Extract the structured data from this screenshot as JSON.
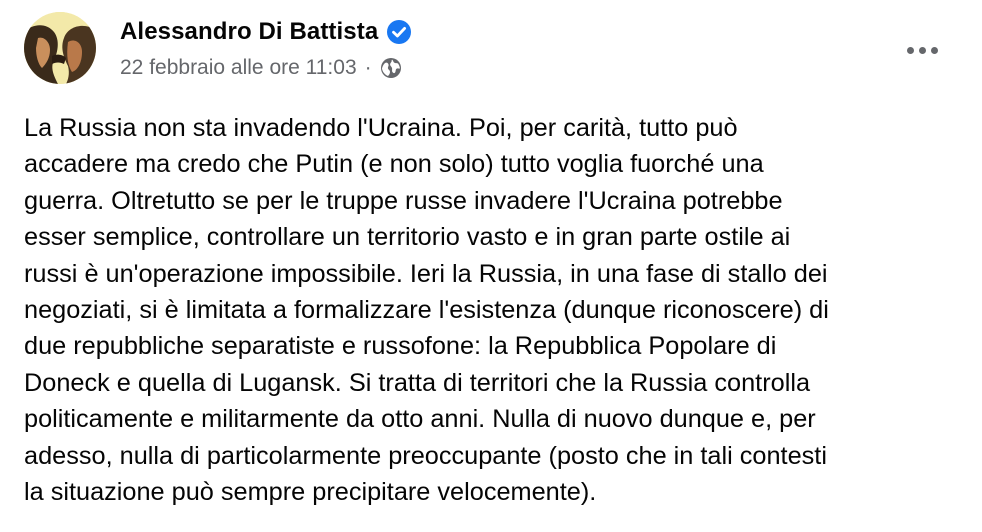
{
  "author": {
    "name": "Alessandro Di Battista",
    "verified": true
  },
  "meta": {
    "timestamp": "22 febbraio alle ore 11:03",
    "separator": "·",
    "audience_icon": "globe-icon"
  },
  "actions": {
    "more_icon": "more-options-icon"
  },
  "post": {
    "lines": [
      "La Russia non sta invadendo l'Ucraina. Poi, per carità, tutto può",
      "accadere ma credo che Putin (e non solo) tutto voglia fuorché una",
      "guerra. Oltretutto se per le truppe russe invadere l'Ucraina potrebbe",
      "esser semplice, controllare un territorio vasto e in gran parte ostile ai",
      "russi è un'operazione impossibile. Ieri la Russia, in una fase di stallo dei",
      "negoziati, si è limitata a formalizzare l'esistenza (dunque riconoscere) di",
      "due repubbliche separatiste e russofone: la Repubblica Popolare di",
      "Doneck e quella di Lugansk. Si tratta di territori che la Russia controlla",
      "politicamente e militarmente da otto anni. Nulla di nuovo dunque e, per",
      "adesso, nulla di particolarmente preoccupante (posto che in tali contesti",
      "la situazione può sempre precipitare velocemente)."
    ]
  },
  "colors": {
    "text_primary": "#050505",
    "text_secondary": "#65676b",
    "verified_blue": "#1877f2",
    "background": "#ffffff"
  }
}
